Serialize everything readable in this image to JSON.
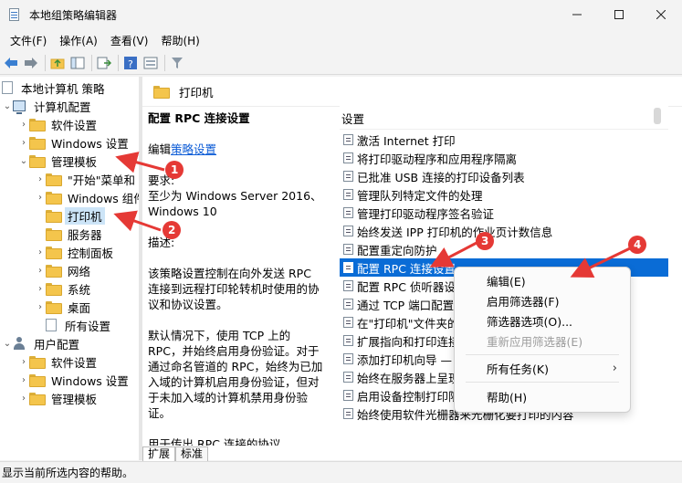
{
  "window": {
    "title": "本地组策略编辑器"
  },
  "menu": [
    "文件(F)",
    "操作(A)",
    "查看(V)",
    "帮助(H)"
  ],
  "tree": {
    "root": "本地计算机 策略",
    "computer_config": "计算机配置",
    "cc_items": [
      "软件设置",
      "Windows 设置",
      "管理模板"
    ],
    "at_items": [
      "\"开始\"菜单和",
      "Windows 组件",
      "打印机",
      "服务器",
      "控制面板",
      "网络",
      "系统",
      "桌面",
      "所有设置"
    ],
    "user_config": "用户配置",
    "uc_items": [
      "软件设置",
      "Windows 设置",
      "管理模板"
    ]
  },
  "right_header": "打印机",
  "description": {
    "title": "配置 RPC 连接设置",
    "edit_prefix": "编辑",
    "edit_link": "策略设置",
    "req_label": "要求:",
    "req_text": "至少为 Windows Server 2016、Windows 10",
    "desc_label": "描述:",
    "p1": "该策略设置控制在向外发送 RPC 连接到远程打印轮转机时使用的协议和协议设置。",
    "p2": "默认情况下，使用 TCP 上的 RPC，并始终启用身份验证。对于通过命名管道的 RPC，始终为已加入域的计算机启用身份验证，但对于未加入域的计算机禁用身份验证。",
    "p3": "用于传出 RPC 连接的协议"
  },
  "list": {
    "header": "设置",
    "rows": [
      "激活 Internet 打印",
      "将打印驱动程序和应用程序隔离",
      "已批准 USB 连接的打印设备列表",
      "管理队列特定文件的处理",
      "管理打印驱动程序签名验证",
      "始终发送 IPP 打印机的作业页计数信息",
      "配置重定向防护",
      "配置 RPC 连接设置",
      "配置 RPC 侦听器设置",
      "通过 TCP 端口配置 RPC",
      "在\"打印机\"文件夹的",
      "扩展指向和打印连接",
      "添加打印机向导 —",
      "始终在服务器上呈现",
      "启用设备控制打印限制",
      "始终使用软件光栅器来光栅化要打印的内容"
    ],
    "selected_index": 7
  },
  "context_menu": {
    "items": [
      "编辑(E)",
      "启用筛选器(F)",
      "筛选器选项(O)...",
      "重新应用筛选器(E)",
      "所有任务(K)",
      "帮助(H)"
    ],
    "disabled_index": 3
  },
  "tabs": [
    "扩展",
    "标准"
  ],
  "status": "显示当前所选内容的帮助。",
  "badges": [
    "1",
    "2",
    "3",
    "4"
  ],
  "colors": {
    "accent": "#0a6cd6",
    "annotation": "#e53935",
    "folder": "#f4c54c"
  }
}
